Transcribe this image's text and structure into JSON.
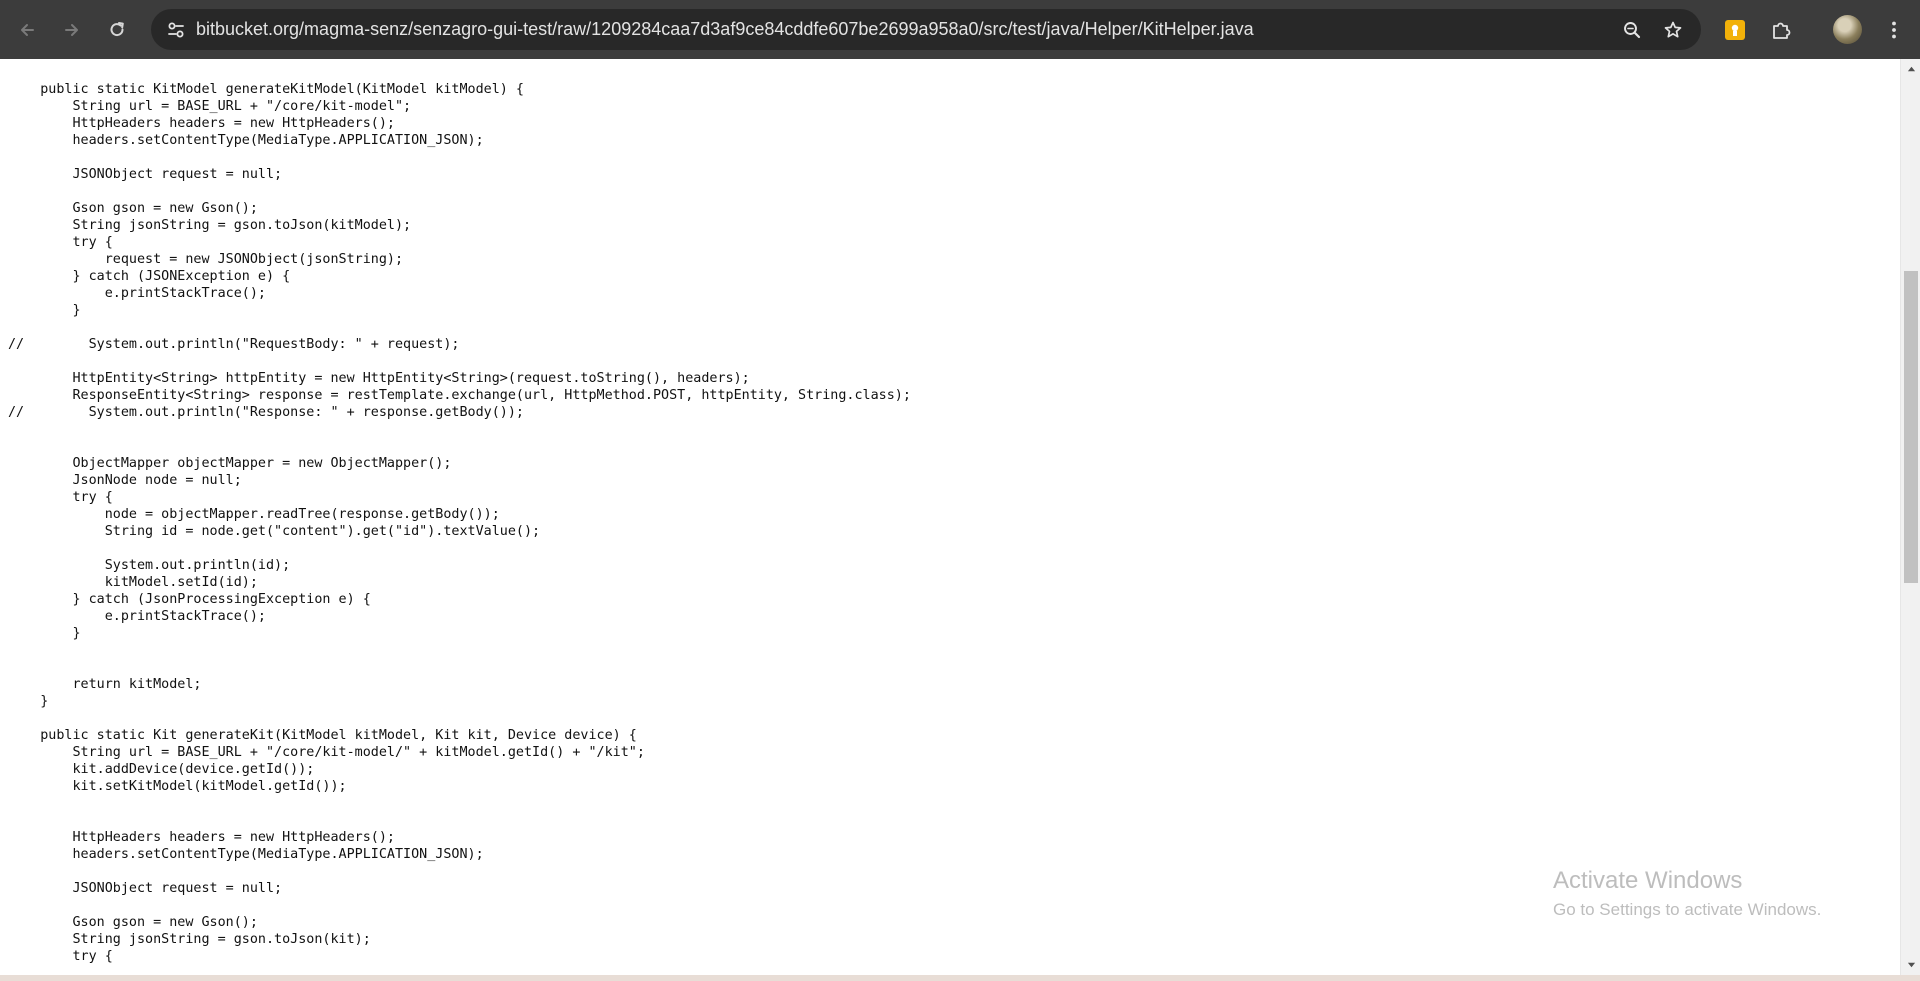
{
  "browser": {
    "url": "bitbucket.org/magma-senz/senzagro-gui-test/raw/1209284caa7d3af9ce84cddfe607be2699a958a0/src/test/java/Helper/KitHelper.java",
    "icons": {
      "back": "arrow-left-icon",
      "forward": "arrow-right-icon",
      "reload": "reload-icon",
      "site_info": "tune-icon",
      "zoom": "zoom-icon",
      "bookmark": "star-icon",
      "extension": "extension-icon",
      "extensions_menu": "puzzle-icon",
      "menu": "kebab-menu-icon"
    },
    "colors": {
      "toolbar": "#3c3c3c",
      "omnibox": "#282828",
      "extension_badge": "#f2b10a"
    }
  },
  "code_lines": [
    "    public static KitModel generateKitModel(KitModel kitModel) {",
    "        String url = BASE_URL + \"/core/kit-model\";",
    "        HttpHeaders headers = new HttpHeaders();",
    "        headers.setContentType(MediaType.APPLICATION_JSON);",
    "",
    "        JSONObject request = null;",
    "",
    "        Gson gson = new Gson();",
    "        String jsonString = gson.toJson(kitModel);",
    "        try {",
    "            request = new JSONObject(jsonString);",
    "        } catch (JSONException e) {",
    "            e.printStackTrace();",
    "        }",
    "",
    "//        System.out.println(\"RequestBody: \" + request);",
    "",
    "        HttpEntity<String> httpEntity = new HttpEntity<String>(request.toString(), headers);",
    "        ResponseEntity<String> response = restTemplate.exchange(url, HttpMethod.POST, httpEntity, String.class);",
    "//        System.out.println(\"Response: \" + response.getBody());",
    "",
    "",
    "        ObjectMapper objectMapper = new ObjectMapper();",
    "        JsonNode node = null;",
    "        try {",
    "            node = objectMapper.readTree(response.getBody());",
    "            String id = node.get(\"content\").get(\"id\").textValue();",
    "",
    "            System.out.println(id);",
    "            kitModel.setId(id);",
    "        } catch (JsonProcessingException e) {",
    "            e.printStackTrace();",
    "        }",
    "",
    "",
    "        return kitModel;",
    "    }",
    "",
    "    public static Kit generateKit(KitModel kitModel, Kit kit, Device device) {",
    "        String url = BASE_URL + \"/core/kit-model/\" + kitModel.getId() + \"/kit\";",
    "        kit.addDevice(device.getId());",
    "        kit.setKitModel(kitModel.getId());",
    "",
    "",
    "        HttpHeaders headers = new HttpHeaders();",
    "        headers.setContentType(MediaType.APPLICATION_JSON);",
    "",
    "        JSONObject request = null;",
    "",
    "        Gson gson = new Gson();",
    "        String jsonString = gson.toJson(kit);",
    "        try {"
  ],
  "watermark": {
    "title": "Activate Windows",
    "subtitle": "Go to Settings to activate Windows."
  },
  "scroll": {
    "position_fraction": 0.34
  }
}
